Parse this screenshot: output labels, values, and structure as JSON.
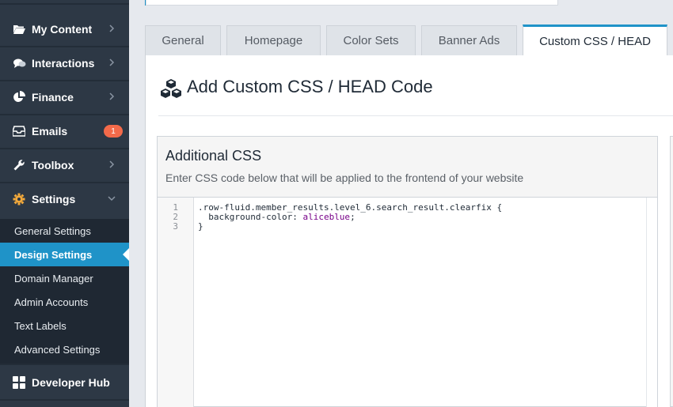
{
  "sidebar": {
    "items": [
      {
        "label": "My Content",
        "icon": "folder-open-icon"
      },
      {
        "label": "Interactions",
        "icon": "chat-bubbles-icon"
      },
      {
        "label": "Finance",
        "icon": "pie-chart-icon"
      },
      {
        "label": "Emails",
        "icon": "inbox-icon",
        "badge": "1"
      },
      {
        "label": "Toolbox",
        "icon": "wrench-icon"
      },
      {
        "label": "Settings",
        "icon": "gear-icon"
      },
      {
        "label": "Developer Hub",
        "icon": "grid-icon"
      }
    ],
    "settings_submenu": [
      "General Settings",
      "Design Settings",
      "Domain Manager",
      "Admin Accounts",
      "Text Labels",
      "Advanced Settings"
    ],
    "active_submenu": "Design Settings"
  },
  "tabs": [
    {
      "label": "General"
    },
    {
      "label": "Homepage"
    },
    {
      "label": "Color Sets"
    },
    {
      "label": "Banner Ads"
    },
    {
      "label": "Custom CSS / HEAD"
    }
  ],
  "active_tab": "Custom CSS / HEAD",
  "page": {
    "title": "Add Custom CSS / HEAD Code"
  },
  "css_box": {
    "title": "Additional CSS",
    "description": "Enter CSS code below that will be applied to the frontend of your website",
    "line_numbers": [
      "1",
      "2",
      "3"
    ],
    "code": {
      "line1": ".row-fluid.member_results.level_6.search_result.clearfix {",
      "line2_property": "  background-color: ",
      "line2_value": "aliceblue",
      "line2_end": ";",
      "line3": "}"
    }
  },
  "colors": {
    "accent": "#1f93c8",
    "sidebar_bg": "#2d3845",
    "badge": "#f36a4a"
  }
}
